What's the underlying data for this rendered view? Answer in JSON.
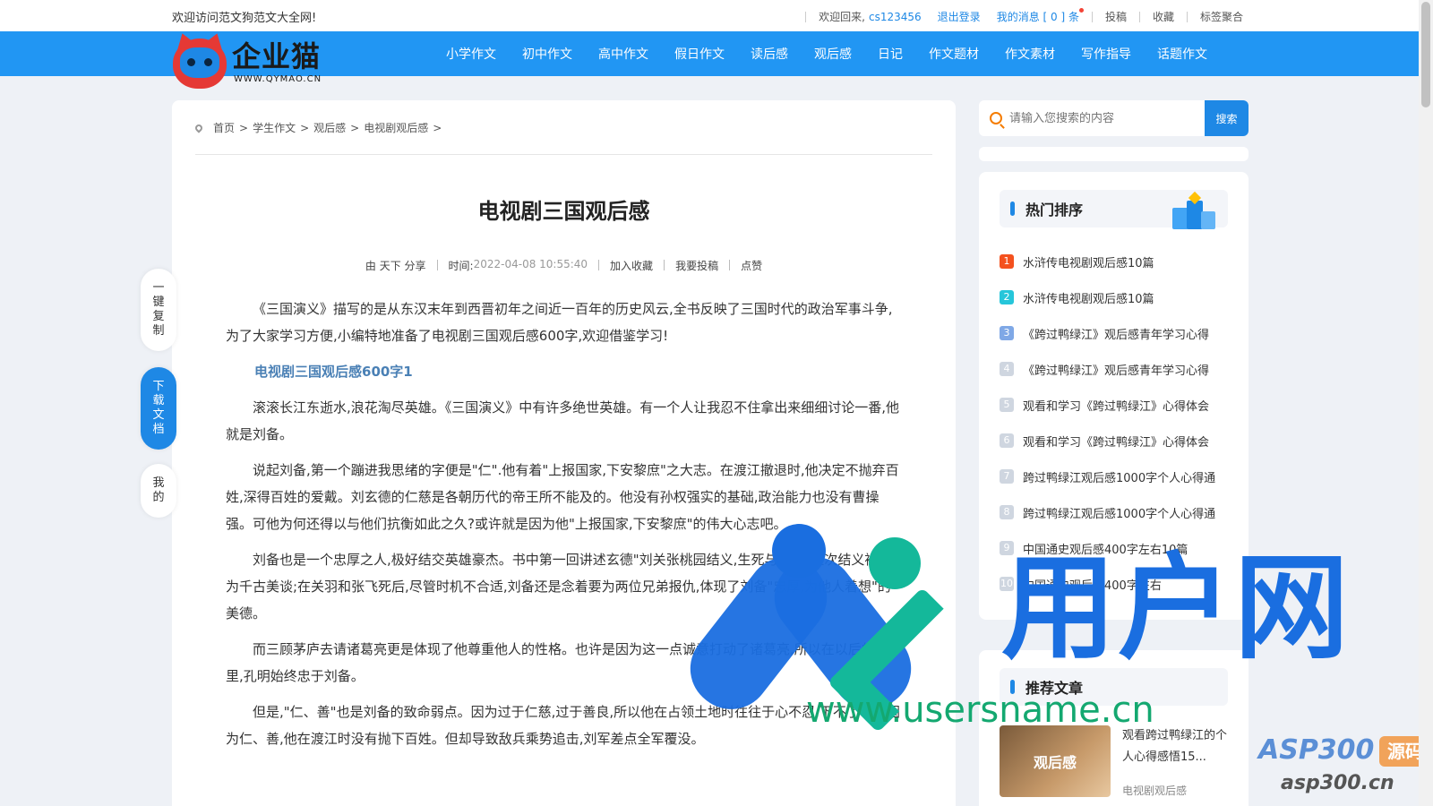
{
  "topbar": {
    "welcome": "欢迎访问范文狗范文大全网!",
    "greeting": "欢迎回来,",
    "username": "cs123456",
    "logout": "退出登录",
    "messages": "我的消息 [ 0 ] 条",
    "links": [
      "投稿",
      "收藏",
      "标签聚合"
    ]
  },
  "logo": {
    "brand": "企业猫",
    "domain": "WWW.QYMAO.CN"
  },
  "nav": {
    "items": [
      "小学作文",
      "初中作文",
      "高中作文",
      "假日作文",
      "读后感",
      "观后感",
      "日记",
      "作文题材",
      "作文素材",
      "写作指导",
      "话题作文"
    ]
  },
  "breadcrumb": [
    "首页",
    "学生作文",
    "观后感",
    "电视剧观后感"
  ],
  "article": {
    "title": "电视剧三国观后感",
    "author": "由 天下 分享",
    "time_label": "时间:",
    "time": "2022-04-08 10:55:40",
    "actions": [
      "加入收藏",
      "我要投稿",
      "点赞"
    ],
    "intro": "《三国演义》描写的是从东汉末年到西晋初年之间近一百年的历史风云,全书反映了三国时代的政治军事斗争,为了大家学习方便,小编特地准备了电视剧三国观后感600字,欢迎借鉴学习!",
    "section_title": "电视剧三国观后感600字1",
    "paragraphs": [
      "滚滚长江东逝水,浪花淘尽英雄。《三国演义》中有许多绝世英雄。有一个人让我忍不住拿出来细细讨论一番,他就是刘备。",
      "说起刘备,第一个蹦进我思绪的字便是\"仁\".他有着\"上报国家,下安黎庶\"之大志。在渡江撤退时,他决定不抛弃百姓,深得百姓的爱戴。刘玄德的仁慈是各朝历代的帝王所不能及的。他没有孙权强实的基础,政治能力也没有曹操强。可他为何还得以与他们抗衡如此之久?或许就是因为他\"上报国家,下安黎庶\"的伟大心志吧。",
      "刘备也是一个忠厚之人,极好结交英雄豪杰。书中第一回讲述玄德\"刘关张桃园结义,生死与共\"。这次结义被誉为千古美谈;在关羽和张飞死后,尽管时机不合适,刘备还是念着要为两位兄弟报仇,体现了刘备\"忠厚,为他人着想\"的美德。",
      "而三顾茅庐去请诸葛亮更是体现了他尊重他人的性格。也许是因为这一点诚意打动了诸葛亮,所以在以后的日子里,孔明始终忠于刘备。",
      "但是,\"仁、善\"也是刘备的致命弱点。因为过于仁慈,过于善良,所以他在占领土地时往往于心不忍,下不了手。因为仁、善,他在渡江时没有抛下百姓。但却导致敌兵乘势追击,刘军差点全军覆没。"
    ]
  },
  "float_buttons": [
    "一键复制",
    "下载文档",
    "我的"
  ],
  "search": {
    "placeholder": "请输入您搜索的内容",
    "button": "搜索"
  },
  "hot": {
    "title": "热门排序",
    "items": [
      {
        "num": "1",
        "text": "水浒传电视剧观后感10篇",
        "color": "#f4511e"
      },
      {
        "num": "2",
        "text": "水浒传电视剧观后感10篇",
        "color": "#26c6da"
      },
      {
        "num": "3",
        "text": "《跨过鸭绿江》观后感青年学习心得",
        "color": "#7fa8e6"
      },
      {
        "num": "4",
        "text": "《跨过鸭绿江》观后感青年学习心得",
        "color": "#cfd6e0"
      },
      {
        "num": "5",
        "text": "观看和学习《跨过鸭绿江》心得体会",
        "color": "#cfd6e0"
      },
      {
        "num": "6",
        "text": "观看和学习《跨过鸭绿江》心得体会",
        "color": "#cfd6e0"
      },
      {
        "num": "7",
        "text": "跨过鸭绿江观后感1000字个人心得通",
        "color": "#cfd6e0"
      },
      {
        "num": "8",
        "text": "跨过鸭绿江观后感1000字个人心得通",
        "color": "#cfd6e0"
      },
      {
        "num": "9",
        "text": "中国通史观后感400字左右10篇",
        "color": "#cfd6e0"
      },
      {
        "num": "10",
        "text": "中国通史观后感400字左右",
        "color": "#cfd6e0"
      }
    ]
  },
  "recommend": {
    "title": "推荐文章",
    "thumb_label": "观后感",
    "item_title": "观看跨过鸭绿江的个人心得感悟15...",
    "item_category": "电视剧观后感"
  },
  "watermark": {
    "big": "用户网",
    "url": "www.usersname.cn",
    "asp": "ASP300",
    "code": "源码",
    "asp_domain": "asp300.cn"
  }
}
